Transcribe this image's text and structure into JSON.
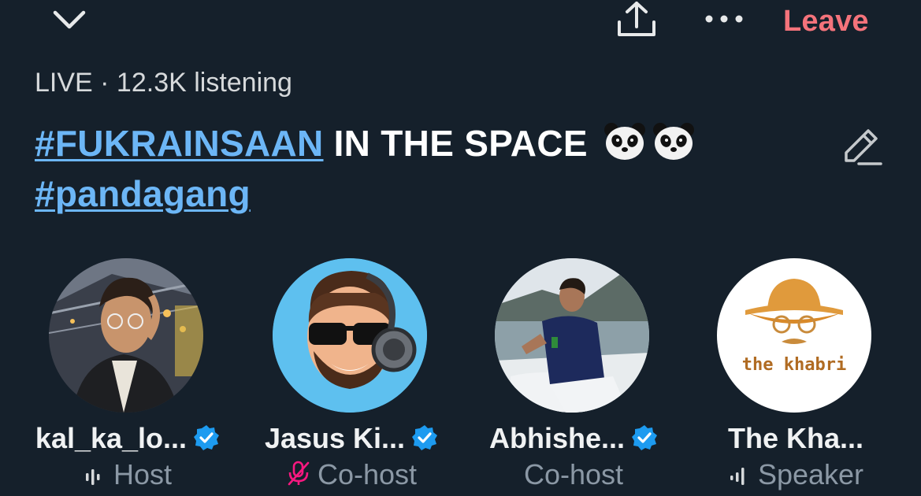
{
  "header": {
    "collapse_icon": "chevron-down-icon",
    "share_icon": "share-icon",
    "more_icon": "more-icon",
    "leave_label": "Leave"
  },
  "space": {
    "status": "LIVE · 12.3K listening",
    "hashtag1": "#FUKRAINSAAN",
    "title_text": " IN THE SPACE ",
    "emoji": "panda",
    "hashtag2": "#pandagang"
  },
  "participants": [
    {
      "name": "kal_ka_lo...",
      "role": "Host",
      "role_icon": "speaking-bars-icon",
      "verified": true
    },
    {
      "name": "Jasus Ki...",
      "role": "Co-host",
      "role_icon": "mic-muted-icon",
      "verified": true
    },
    {
      "name": "Abhishe...",
      "role": "Co-host",
      "role_icon": "",
      "verified": true
    },
    {
      "name": "The Kha...",
      "role": "Speaker",
      "role_icon": "speaking-bars-icon",
      "verified": false,
      "avatar_text": "the khabri"
    }
  ],
  "colors": {
    "background": "#15202b",
    "leave": "#f4737b",
    "hashtag": "#6cb6f6",
    "verified": "#1d9bf0",
    "muted": "#f91880",
    "secondary": "#8b98a5"
  }
}
